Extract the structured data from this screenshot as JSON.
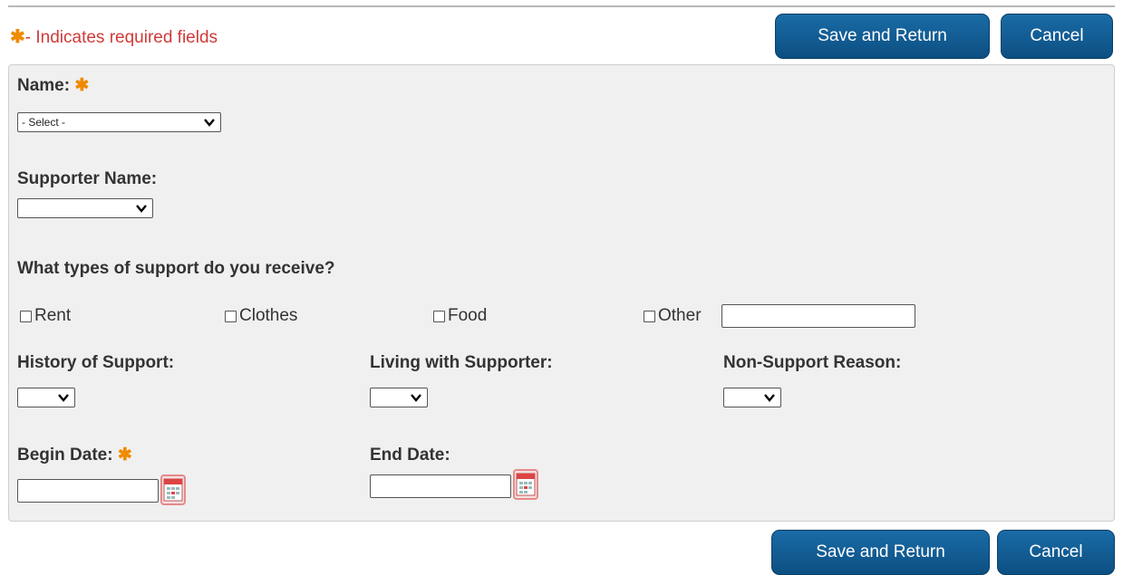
{
  "header": {
    "required_star": "✱",
    "required_note": "- Indicates required fields",
    "save_label": "Save and Return",
    "cancel_label": "Cancel"
  },
  "form": {
    "name_label": "Name:",
    "name_select_value": "- Select -",
    "supporter_label": "Supporter Name:",
    "supporter_select_value": "",
    "support_question": "What types of support do you receive?",
    "support_types": [
      "Rent",
      "Clothes",
      "Food",
      "Other"
    ],
    "other_value": "",
    "history_label": "History of Support:",
    "living_label": "Living with Supporter:",
    "nonsupport_label": "Non-Support Reason:",
    "begin_date_label": "Begin Date:",
    "begin_date_value": "",
    "end_date_label": "End Date:",
    "end_date_value": ""
  },
  "footer": {
    "save_label": "Save and Return",
    "cancel_label": "Cancel"
  },
  "colors": {
    "button": "#0c4f82",
    "required": "#f08a00",
    "note": "#d03a3a",
    "panel": "#f0f0f0"
  }
}
